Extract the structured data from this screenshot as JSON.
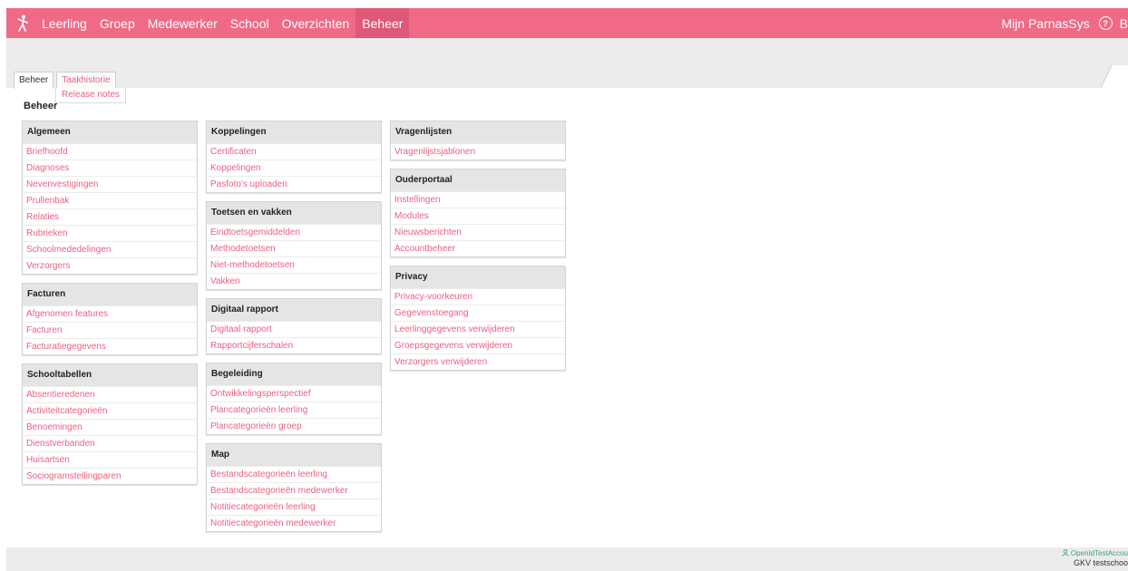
{
  "nav": {
    "items": [
      "Leerling",
      "Groep",
      "Medewerker",
      "School",
      "Overzichten",
      "Beheer"
    ],
    "active": "Beheer",
    "right_label": "Mijn ParnasSys",
    "help_glyph": "?",
    "cut_glyph": "B"
  },
  "tabs": {
    "main": "Beheer",
    "history": "Taakhistorie",
    "release_notes": "Release notes"
  },
  "page_title": "Beheer",
  "panels": [
    {
      "title": "Algemeen",
      "items": [
        "Briefhoofd",
        "Diagnoses",
        "Nevenvestigingen",
        "Prullenbak",
        "Relaties",
        "Rubrieken",
        "Schoolmededelingen",
        "Verzorgers"
      ]
    },
    {
      "title": "Facturen",
      "items": [
        "Afgenomen features",
        "Facturen",
        "Facturatiegegevens"
      ]
    },
    {
      "title": "Schooltabellen",
      "items": [
        "Absentieredenen",
        "Activiteitcategorieën",
        "Benoemingen",
        "Dienstverbanden",
        "Huisartsen",
        "Sociogramstellingparen"
      ]
    },
    {
      "title": "Koppelingen",
      "items": [
        "Certificaten",
        "Koppelingen",
        "Pasfoto's uploaden"
      ]
    },
    {
      "title": "Toetsen en vakken",
      "items": [
        "Eindtoetsgemiddelden",
        "Methodetoetsen",
        "Niet-methodetoetsen",
        "Vakken"
      ]
    },
    {
      "title": "Digitaal rapport",
      "items": [
        "Digitaal rapport",
        "Rapportcijferschalen"
      ]
    },
    {
      "title": "Begeleiding",
      "items": [
        "Ontwikkelingsperspectief",
        "Plancategorieën leerling",
        "Plancategorieën groep"
      ]
    },
    {
      "title": "Map",
      "items": [
        "Bestandscategorieën leerling",
        "Bestandscategorieën medewerker",
        "Notitiecategorieën leerling",
        "Notitiecategorieën medewerker"
      ]
    },
    {
      "title": "Vragenlijsten",
      "items": [
        "Vragenlijstsjablonen"
      ]
    },
    {
      "title": "Ouderportaal",
      "items": [
        "Instellingen",
        "Modules",
        "Nieuwsberichten",
        "Accountbeheer"
      ]
    },
    {
      "title": "Privacy",
      "items": [
        "Privacy-voorkeuren",
        "Gegevenstoegang",
        "Leerlinggegevens verwijderen",
        "Groepsgegevens verwijderen",
        "Verzorgers verwijderen"
      ]
    }
  ],
  "footer": {
    "user": "OpenIdTestAccou",
    "school": "GKV testschoo"
  },
  "colors": {
    "brand": "#f06a86",
    "link": "#e8627f",
    "user": "#3ca57a"
  },
  "icons": {
    "logo": "dancer-logo-icon",
    "help": "help-circle-icon",
    "user": "user-icon"
  }
}
